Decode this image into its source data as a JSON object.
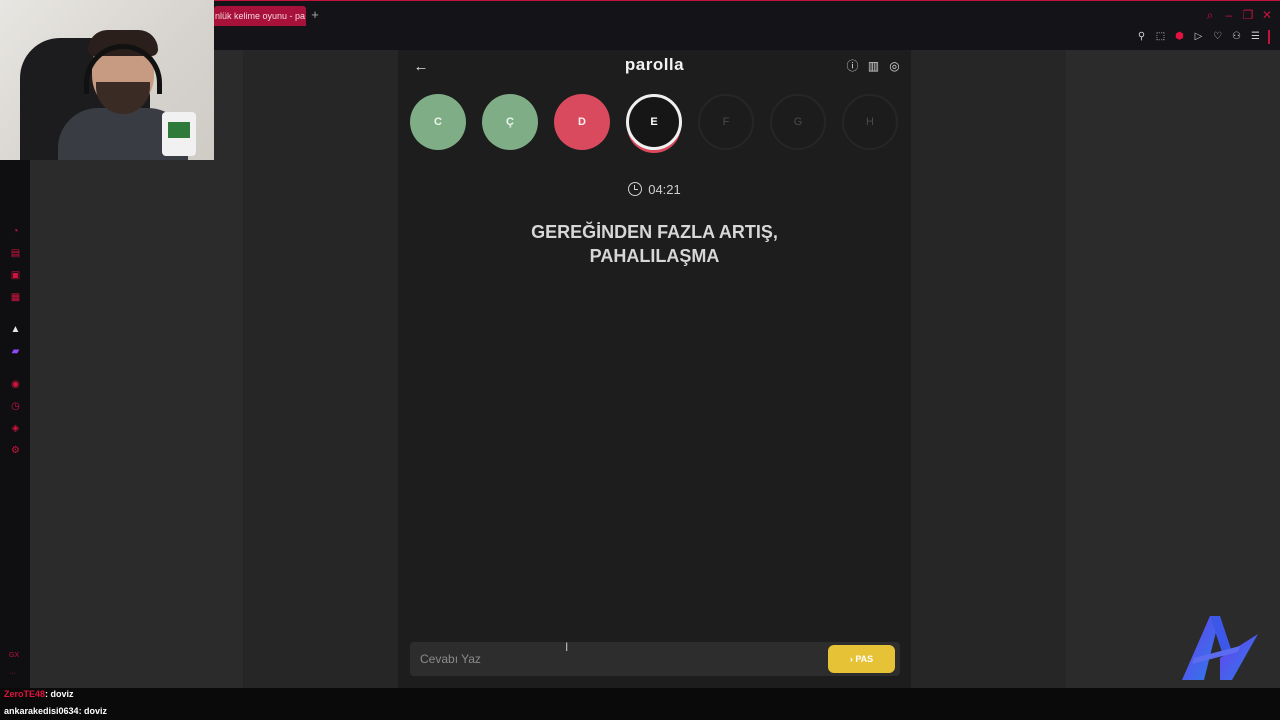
{
  "browser": {
    "tab_title": "nlük kelime oyunu - pa",
    "tab_add": "+"
  },
  "app": {
    "title": "parolla",
    "letters": [
      {
        "label": "C",
        "state": "correct"
      },
      {
        "label": "Ç",
        "state": "correct"
      },
      {
        "label": "D",
        "state": "wrong"
      },
      {
        "label": "E",
        "state": "current"
      },
      {
        "label": "F",
        "state": "pending"
      },
      {
        "label": "G",
        "state": "pending"
      },
      {
        "label": "H",
        "state": "pending"
      }
    ],
    "timer": "04:21",
    "question_line1": "GEREĞİNDEN FAZLA ARTIŞ,",
    "question_line2": "PAHALILAŞMA",
    "answer_placeholder": "Cevabı Yaz",
    "pass_label": "PAS"
  },
  "chat": [
    {
      "user": "ZeroTE48",
      "message": ": doviz",
      "user_color": "#e0123f"
    },
    {
      "user": "ankarakedisi0634",
      "message": ": doviz",
      "user_color": "#ffffff"
    }
  ],
  "colors": {
    "correct": "#7fad86",
    "wrong": "#d94a5e",
    "pass_button": "#e6c236",
    "accent": "#c3123c"
  }
}
